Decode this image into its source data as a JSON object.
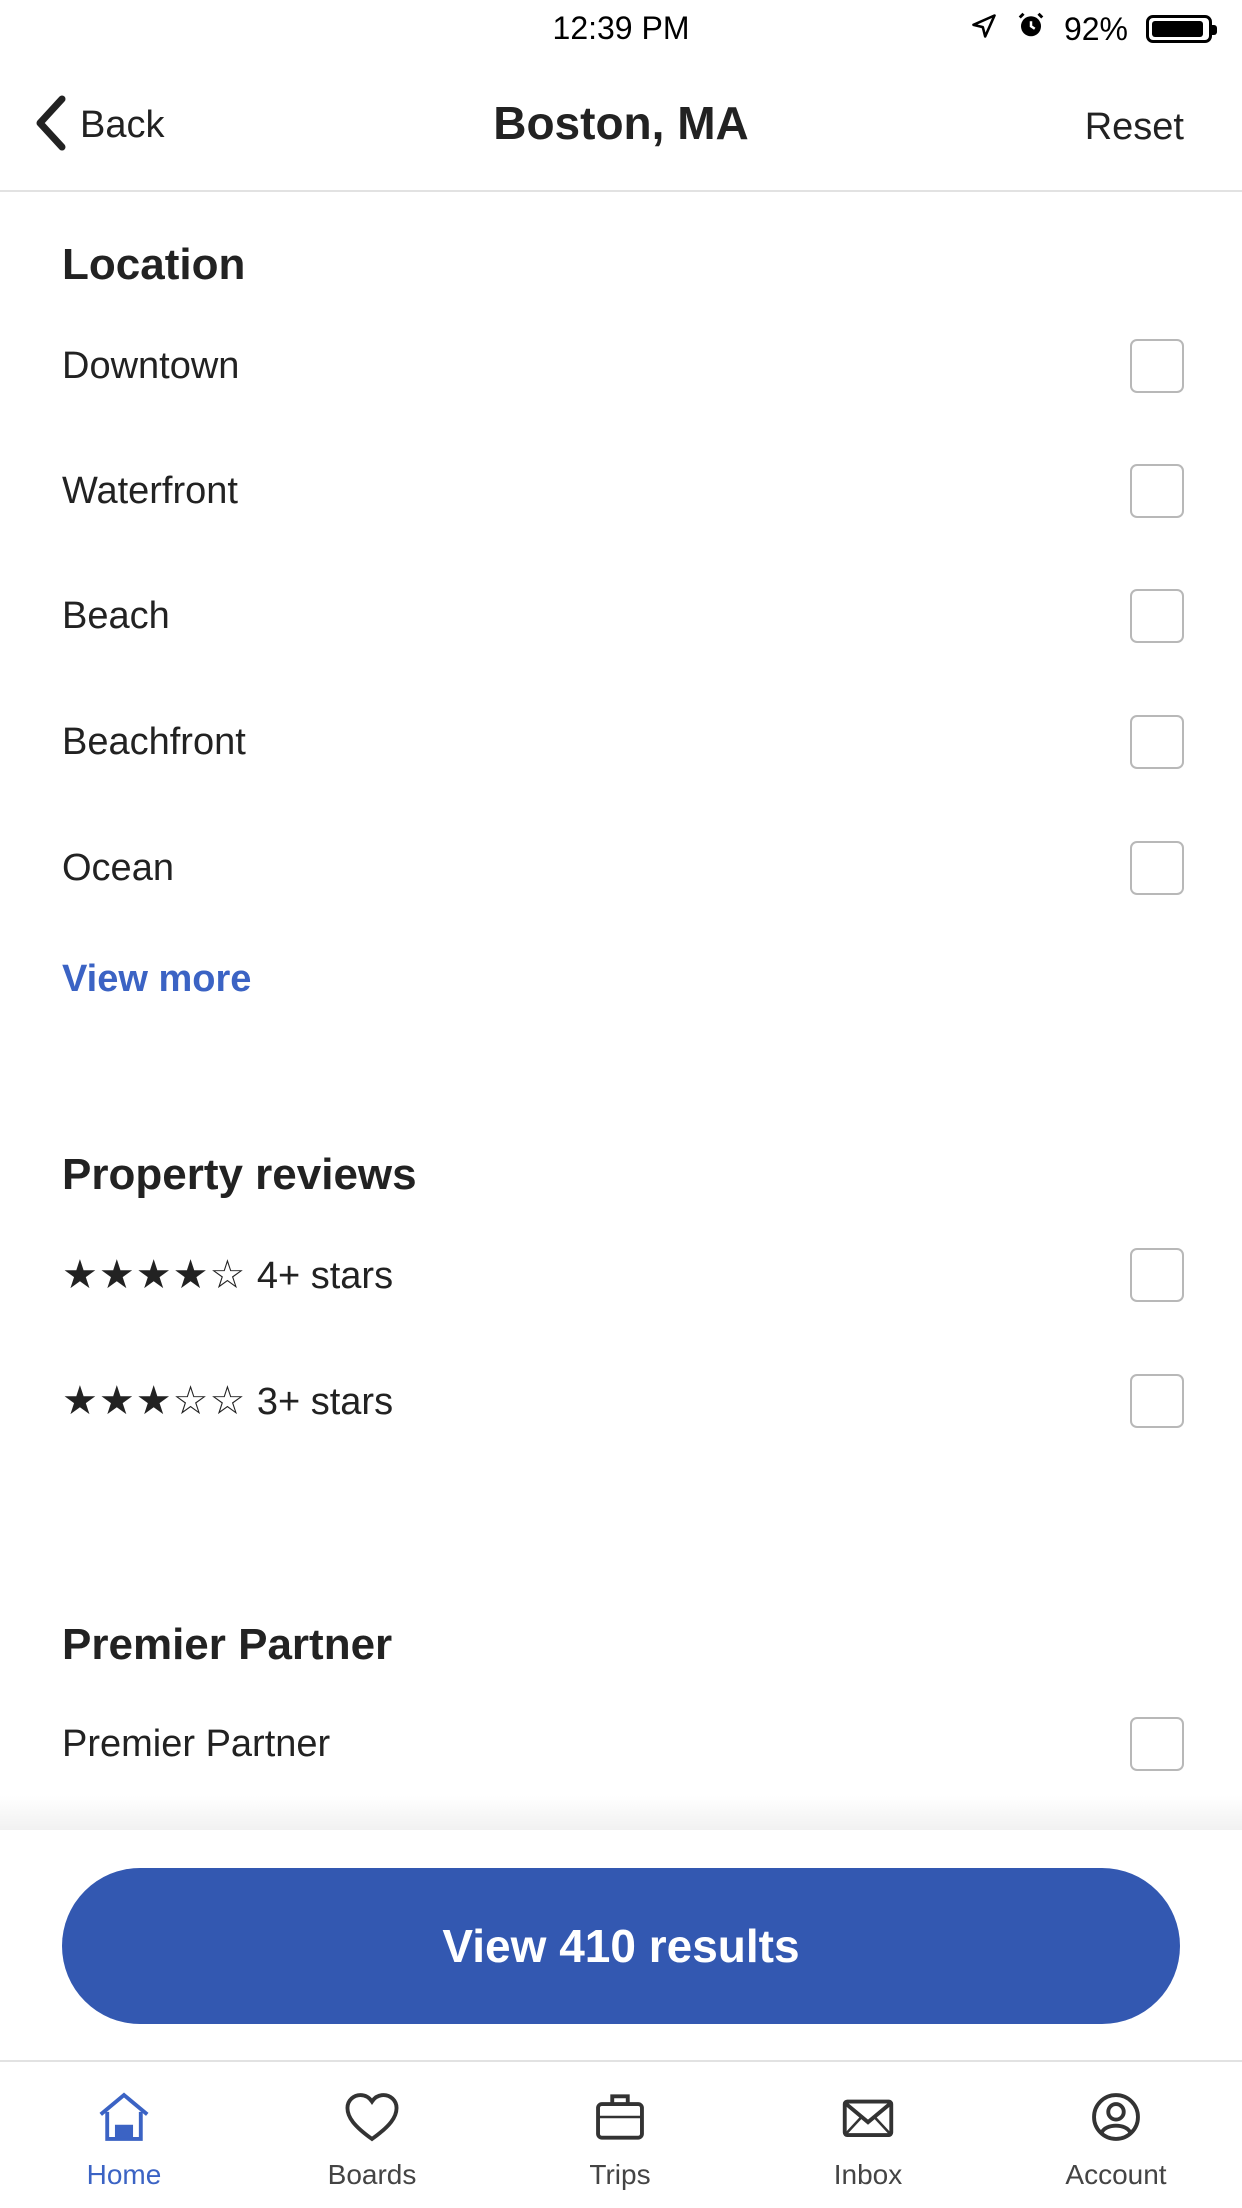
{
  "status_bar": {
    "time": "12:39 PM",
    "battery": "92%",
    "icons": [
      "location-arrow-icon",
      "alarm-icon",
      "battery-icon"
    ]
  },
  "header": {
    "back_label": "Back",
    "title": "Boston, MA",
    "reset_label": "Reset"
  },
  "location": {
    "title": "Location",
    "options": [
      {
        "label": "Downtown",
        "checked": false
      },
      {
        "label": "Waterfront",
        "checked": false
      },
      {
        "label": "Beach",
        "checked": false
      },
      {
        "label": "Beachfront",
        "checked": false
      },
      {
        "label": "Ocean",
        "checked": false
      }
    ],
    "view_more": "View more"
  },
  "reviews": {
    "title": "Property reviews",
    "options": [
      {
        "stars": "★★★★☆",
        "label": "4+ stars",
        "checked": false
      },
      {
        "stars": "★★★☆☆",
        "label": "3+ stars",
        "checked": false
      }
    ]
  },
  "partner": {
    "title": "Premier Partner",
    "options": [
      {
        "label": "Premier Partner",
        "checked": false
      }
    ]
  },
  "cta": {
    "label": "View 410 results"
  },
  "tab_bar": {
    "tabs": [
      {
        "label": "Home",
        "icon": "home-icon",
        "active": true
      },
      {
        "label": "Boards",
        "icon": "heart-icon",
        "active": false
      },
      {
        "label": "Trips",
        "icon": "suitcase-icon",
        "active": false
      },
      {
        "label": "Inbox",
        "icon": "envelope-icon",
        "active": false
      },
      {
        "label": "Account",
        "icon": "account-icon",
        "active": false
      }
    ]
  },
  "colors": {
    "accent": "#3b63c4",
    "cta_background": "#3358b1"
  }
}
